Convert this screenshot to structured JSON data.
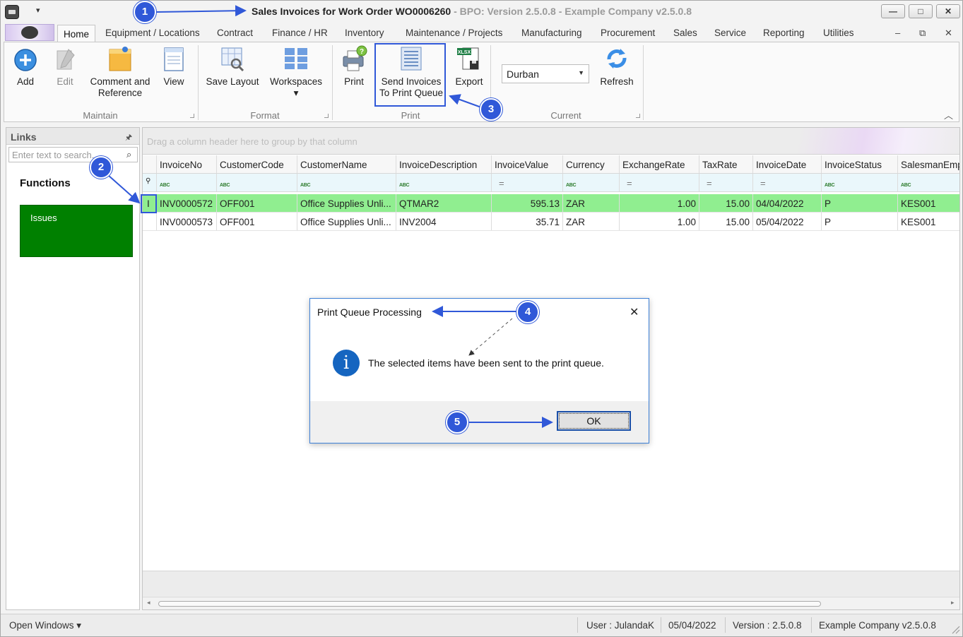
{
  "titlebar": {
    "title": "Sales Invoices for Work Order WO0006260",
    "version": " - BPO: Version 2.5.0.8 - Example Company v2.5.0.8",
    "minimize": "—",
    "maximize": "□",
    "close": "✕",
    "qat_dropdown": "▾"
  },
  "tabs": [
    "Home",
    "Equipment / Locations",
    "Contract",
    "Finance / HR",
    "Inventory",
    "Maintenance / Projects",
    "Manufacturing",
    "Procurement",
    "Sales",
    "Service",
    "Reporting",
    "Utilities"
  ],
  "mdi_controls": {
    "minimize": "–",
    "restore": "⧉",
    "close": "✕"
  },
  "ribbon": {
    "maintain": {
      "label": "Maintain",
      "add": "Add",
      "edit": "Edit",
      "comment_line1": "Comment and",
      "comment_line2": "Reference",
      "view": "View"
    },
    "format": {
      "label": "Format",
      "save_layout": "Save Layout",
      "workspaces": "Workspaces",
      "workspaces_arrow": "▾"
    },
    "print": {
      "label": "Print",
      "print": "Print",
      "send_line1": "Send Invoices",
      "send_line2": "To Print Queue",
      "export": "Export"
    },
    "current": {
      "label": "Current",
      "branch": "Durban",
      "dropdown_arrow": "▼",
      "refresh": "Refresh"
    },
    "collapse_glyph": "︿"
  },
  "links": {
    "title": "Links",
    "pin_glyph": "🖈",
    "search_placeholder": "Enter text to search...",
    "search_glyph": "⌕",
    "functions": "Functions",
    "issues": "Issues"
  },
  "grid": {
    "group_hint": "Drag a column header here to group by that column",
    "filter_row_glyph": "⚲",
    "filter_abc": "ABC",
    "filter_eq": "=",
    "columns": [
      "InvoiceNo",
      "CustomerCode",
      "CustomerName",
      "InvoiceDescription",
      "InvoiceValue",
      "Currency",
      "ExchangeRate",
      "TaxRate",
      "InvoiceDate",
      "InvoiceStatus",
      "SalesmanEmpl"
    ],
    "rows": [
      {
        "indicator": "I",
        "InvoiceNo": "INV0000572",
        "CustomerCode": "OFF001",
        "CustomerName": "Office Supplies Unli...",
        "InvoiceDescription": "QTMAR2",
        "InvoiceValue": "595.13",
        "Currency": "ZAR",
        "ExchangeRate": "1.00",
        "TaxRate": "15.00",
        "InvoiceDate": "04/04/2022",
        "InvoiceStatus": "P",
        "SalesmanEmpl": "KES001"
      },
      {
        "indicator": "",
        "InvoiceNo": "INV0000573",
        "CustomerCode": "OFF001",
        "CustomerName": "Office Supplies Unli...",
        "InvoiceDescription": "INV2004",
        "InvoiceValue": "35.71",
        "Currency": "ZAR",
        "ExchangeRate": "1.00",
        "TaxRate": "15.00",
        "InvoiceDate": "05/04/2022",
        "InvoiceStatus": "P",
        "SalesmanEmpl": "KES001"
      }
    ],
    "scroll_left": "◂",
    "scroll_right": "▸"
  },
  "statusbar": {
    "open_windows": "Open Windows ▾",
    "user": "User : JulandaK",
    "date": "05/04/2022",
    "version": "Version : 2.5.0.8",
    "company": "Example Company v2.5.0.8"
  },
  "dialog": {
    "title": "Print Queue Processing",
    "close": "✕",
    "info_glyph": "i",
    "message": "The selected items have been sent to the print queue.",
    "ok": "OK"
  },
  "annotations": [
    "1",
    "2",
    "3",
    "4",
    "5"
  ],
  "colors": {
    "selected_row": "#90ee90",
    "issues_tile": "#008000",
    "annotation": "#3058d8",
    "dialog_border": "#3c7fd6"
  }
}
